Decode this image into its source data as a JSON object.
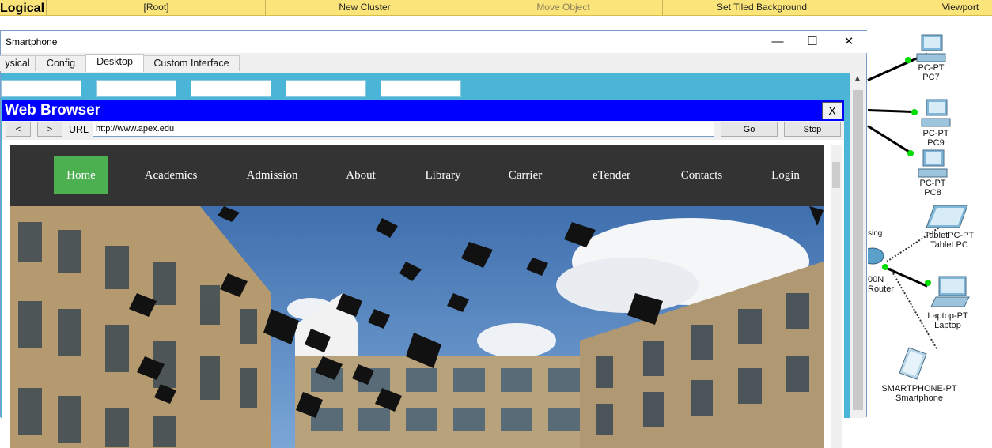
{
  "topbar": {
    "mode": "Logical",
    "items": [
      "[Root]",
      "New Cluster",
      "Move Object",
      "Set Tiled Background",
      "Viewport"
    ]
  },
  "network": {
    "devices": [
      {
        "type": "PC-PT",
        "name": "PC7"
      },
      {
        "type": "PC-PT",
        "name": "PC9"
      },
      {
        "type": "PC-PT",
        "name": "PC8"
      },
      {
        "type": "TabletPC-PT",
        "name": "Tablet PC"
      },
      {
        "type": "Laptop-PT",
        "name": "Laptop"
      },
      {
        "type": "SMARTPHONE-PT",
        "name": "Smartphone"
      }
    ],
    "router_label_partial": "sing",
    "router_model_partial": "00N",
    "router_name_partial": "Router",
    "link_color": "#000000",
    "port_color": "#00dd00"
  },
  "window": {
    "title": "Smartphone",
    "controls": {
      "minimize": "—",
      "maximize": "☐",
      "close": "✕"
    },
    "tabs": [
      "ysical",
      "Config",
      "Desktop",
      "Custom Interface"
    ],
    "active_tab": "Desktop"
  },
  "browser": {
    "title": "Web Browser",
    "close_label": "X",
    "back_label": "<",
    "forward_label": ">",
    "url_label": "URL",
    "url": "http://www.apex.edu",
    "go_label": "Go",
    "stop_label": "Stop"
  },
  "site": {
    "nav": [
      "Home",
      "Academics",
      "Admission",
      "About",
      "Library",
      "Carrier",
      "eTender",
      "Contacts",
      "Login"
    ],
    "active": "Home",
    "nav_bg": "#333333",
    "active_bg": "#4caf50"
  },
  "colors": {
    "topbar": "#fbe57a",
    "desktop": "#4bb5d8",
    "browser_title": "#0000ff"
  }
}
